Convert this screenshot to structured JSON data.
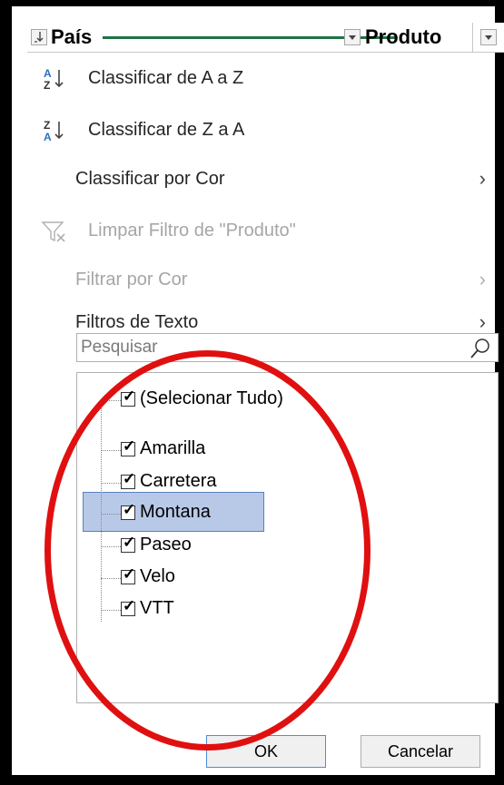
{
  "header": {
    "col1_label": "País",
    "col2_label": "Produto"
  },
  "menu": {
    "sort_az": "Classificar de A a Z",
    "sort_za": "Classificar de Z a A",
    "sort_color": "Classificar por Cor",
    "clear_filter": "Limpar Filtro de \"Produto\"",
    "filter_color": "Filtrar por Cor",
    "text_filters": "Filtros de Texto"
  },
  "search": {
    "placeholder": "Pesquisar"
  },
  "list": {
    "items": [
      {
        "label": "(Selecionar Tudo)",
        "checked": true
      },
      {
        "label": "Amarilla",
        "checked": true
      },
      {
        "label": "Carretera",
        "checked": true
      },
      {
        "label": "Montana",
        "checked": true,
        "selected": true
      },
      {
        "label": "Paseo",
        "checked": true
      },
      {
        "label": "Velo",
        "checked": true
      },
      {
        "label": "VTT",
        "checked": true
      }
    ]
  },
  "buttons": {
    "ok": "OK",
    "cancel": "Cancelar"
  },
  "colors": {
    "annotation": "#e01010",
    "selection": "#b8c9e8",
    "excel_green": "#217346"
  }
}
